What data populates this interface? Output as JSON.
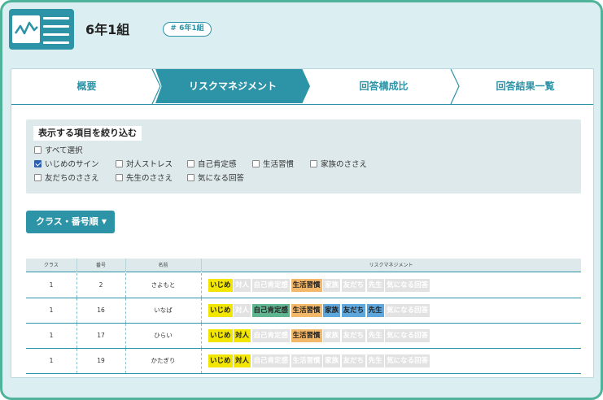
{
  "header": {
    "class_title": "6年1組",
    "class_tag": "# 6年1組"
  },
  "tabs": [
    {
      "label": "概要",
      "active": false
    },
    {
      "label": "リスクマネジメント",
      "active": true
    },
    {
      "label": "回答構成比",
      "active": false
    },
    {
      "label": "回答結果一覧",
      "active": false
    }
  ],
  "filter": {
    "title": "表示する項目を絞り込む",
    "select_all": {
      "label": "すべて選択",
      "checked": false
    },
    "options": [
      {
        "label": "いじめのサイン",
        "checked": true
      },
      {
        "label": "対人ストレス",
        "checked": false
      },
      {
        "label": "自己肯定感",
        "checked": false
      },
      {
        "label": "生活習慣",
        "checked": false
      },
      {
        "label": "家族のささえ",
        "checked": false
      },
      {
        "label": "友だちのささえ",
        "checked": false
      },
      {
        "label": "先生のささえ",
        "checked": false
      },
      {
        "label": "気になる回答",
        "checked": false
      }
    ]
  },
  "sort": {
    "label": "クラス・番号順",
    "caret": "▼"
  },
  "table": {
    "headers": [
      "クラス",
      "番号",
      "名前",
      "リスクマネジメント"
    ],
    "tag_labels": [
      "いじめ",
      "対人",
      "自己肯定感",
      "生活習慣",
      "家族",
      "友だち",
      "先生",
      "気になる回答"
    ],
    "tag_colors": [
      "#f2e600",
      "#f2e600",
      "#5fb58f",
      "#f3b86a",
      "#5ea7dd",
      "#5ea7dd",
      "#5ea7dd",
      "#e2e2e2"
    ],
    "rows": [
      {
        "class": "1",
        "number": "2",
        "name": "さよもと",
        "flags": [
          true,
          false,
          false,
          true,
          false,
          false,
          false,
          false
        ]
      },
      {
        "class": "1",
        "number": "16",
        "name": "いなば",
        "flags": [
          true,
          false,
          true,
          true,
          true,
          true,
          true,
          false
        ]
      },
      {
        "class": "1",
        "number": "17",
        "name": "ひらい",
        "flags": [
          true,
          true,
          false,
          true,
          false,
          false,
          false,
          false
        ]
      },
      {
        "class": "1",
        "number": "19",
        "name": "かたぎり",
        "flags": [
          true,
          true,
          false,
          false,
          false,
          false,
          false,
          false
        ]
      }
    ]
  }
}
